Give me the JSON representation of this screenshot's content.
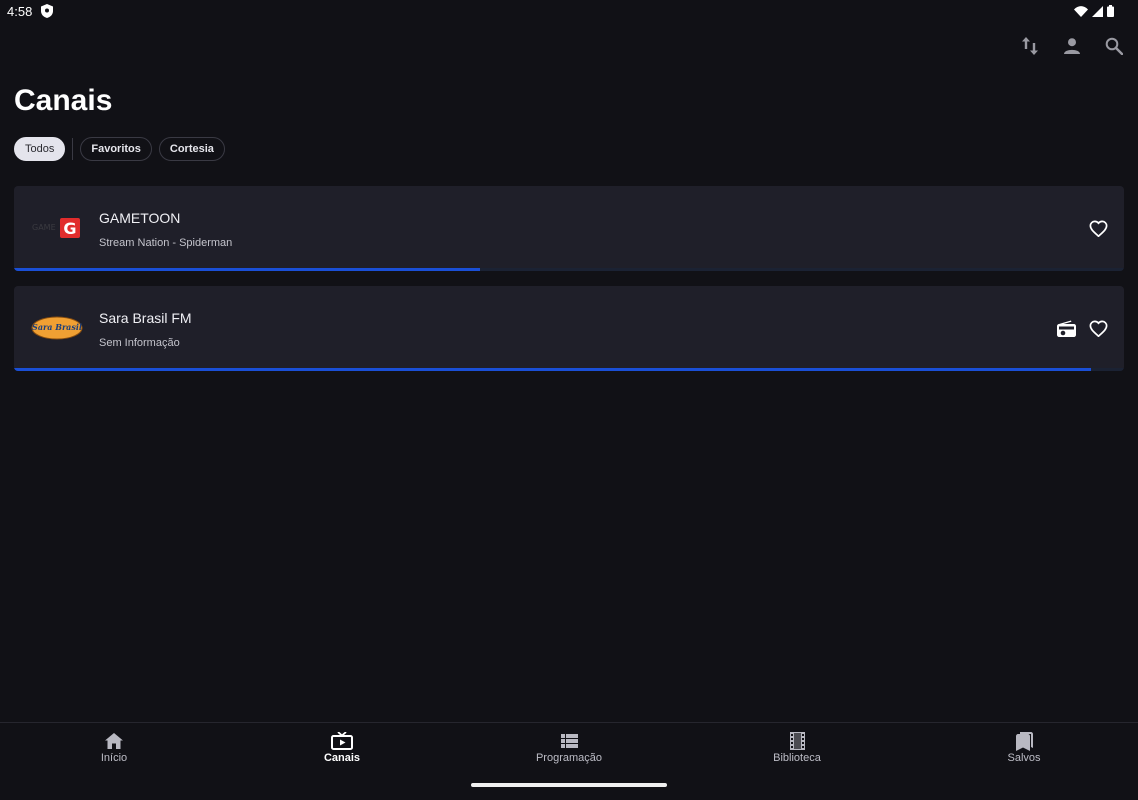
{
  "status_bar": {
    "time": "4:58"
  },
  "page": {
    "title": "Canais"
  },
  "top_actions": {
    "icons": [
      "sort-arrows-icon",
      "account-icon",
      "search-icon"
    ]
  },
  "filters": [
    {
      "label": "Todos",
      "selected": true
    },
    {
      "label": "Favoritos",
      "selected": false
    },
    {
      "label": "Cortesia",
      "selected": false
    }
  ],
  "channels": [
    {
      "name": "GAMETOON",
      "program": "Stream Nation - Spiderman",
      "progress": 0.42,
      "icons": [
        "heart-outline-icon"
      ],
      "logo_text": "G"
    },
    {
      "name": "Sara Brasil FM",
      "program": "Sem Informação",
      "progress": 0.97,
      "icons": [
        "radio-icon",
        "heart-outline-icon"
      ],
      "logo_text": "Sara Brasil"
    }
  ],
  "bottom_nav": [
    {
      "label": "Início",
      "icon": "home-icon",
      "active": false
    },
    {
      "label": "Canais",
      "icon": "tv-icon",
      "active": true
    },
    {
      "label": "Programação",
      "icon": "list-icon",
      "active": false
    },
    {
      "label": "Biblioteca",
      "icon": "film-icon",
      "active": false
    },
    {
      "label": "Salvos",
      "icon": "bookmarks-icon",
      "active": false
    }
  ],
  "colors": {
    "background": "#111116",
    "card": "#1f1f29",
    "progress": "#1a4fd6",
    "chip_selected": "#e4e4ec"
  }
}
